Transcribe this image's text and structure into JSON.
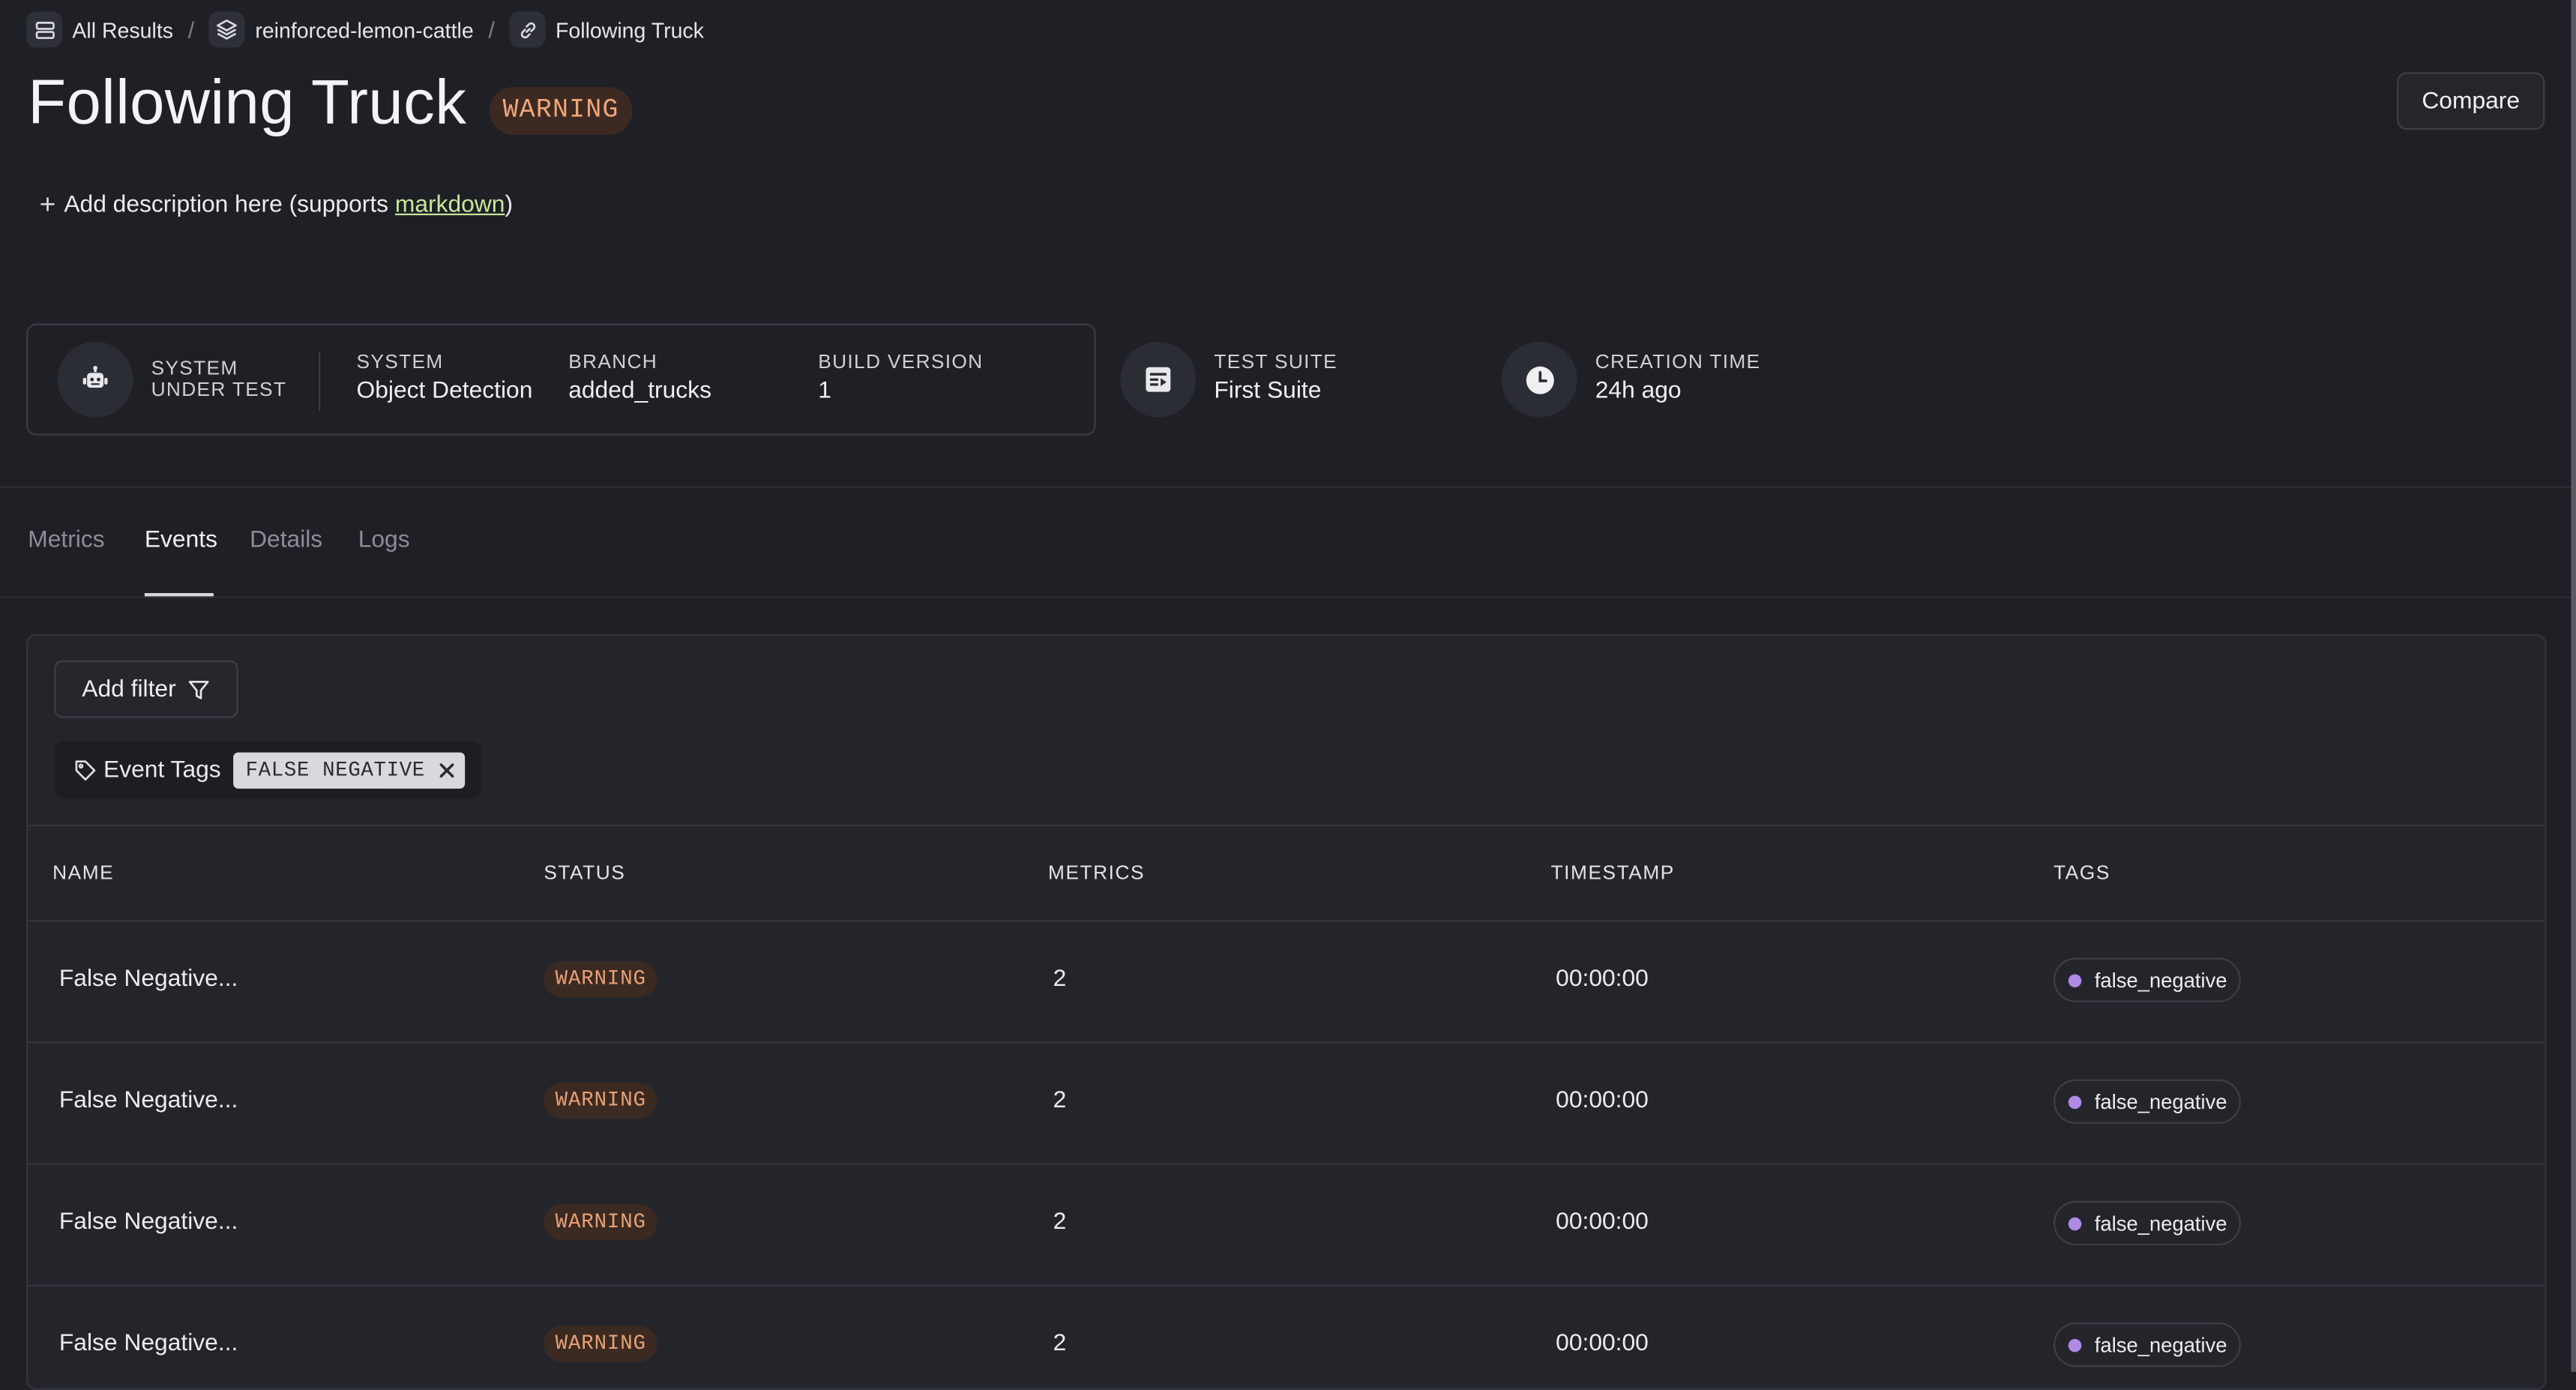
{
  "breadcrumb": [
    {
      "label": "All Results",
      "icon": "stack-rows-icon"
    },
    {
      "label": "reinforced-lemon-cattle",
      "icon": "layers-icon"
    },
    {
      "label": "Following Truck",
      "icon": "link-icon"
    }
  ],
  "breadcrumb_separator": "/",
  "page": {
    "title": "Following Truck",
    "status": "WARNING",
    "compare_label": "Compare",
    "description_prefix": "Add description here (supports ",
    "description_link": "markdown",
    "description_suffix": ")"
  },
  "info": {
    "sut_label": "SYSTEM UNDER TEST",
    "system_label": "SYSTEM",
    "system_value": "Object Detection",
    "branch_label": "BRANCH",
    "branch_value": "added_trucks",
    "build_label": "BUILD VERSION",
    "build_value": "1",
    "suite_label": "TEST SUITE",
    "suite_value": "First Suite",
    "created_label": "CREATION TIME",
    "created_value": "24h ago"
  },
  "tabs": [
    "Metrics",
    "Events",
    "Details",
    "Logs"
  ],
  "active_tab": "Events",
  "filters": {
    "add_label": "Add filter",
    "chip_field": "Event Tags",
    "chip_value": "FALSE NEGATIVE"
  },
  "table": {
    "columns": [
      "NAME",
      "STATUS",
      "METRICS",
      "TIMESTAMP",
      "TAGS"
    ],
    "rows": [
      {
        "name": "False Negative...",
        "status": "WARNING",
        "metrics": "2",
        "timestamp": "00:00:00",
        "tag": "false_negative"
      },
      {
        "name": "False Negative...",
        "status": "WARNING",
        "metrics": "2",
        "timestamp": "00:00:00",
        "tag": "false_negative"
      },
      {
        "name": "False Negative...",
        "status": "WARNING",
        "metrics": "2",
        "timestamp": "00:00:00",
        "tag": "false_negative"
      },
      {
        "name": "False Negative...",
        "status": "WARNING",
        "metrics": "2",
        "timestamp": "00:00:00",
        "tag": "false_negative"
      }
    ]
  },
  "colors": {
    "background": "#1f2026",
    "warning_text": "#f0a577",
    "warning_bg": "#3c2a22",
    "link": "#c6e89a",
    "tag_dot": "#b08ae6"
  }
}
